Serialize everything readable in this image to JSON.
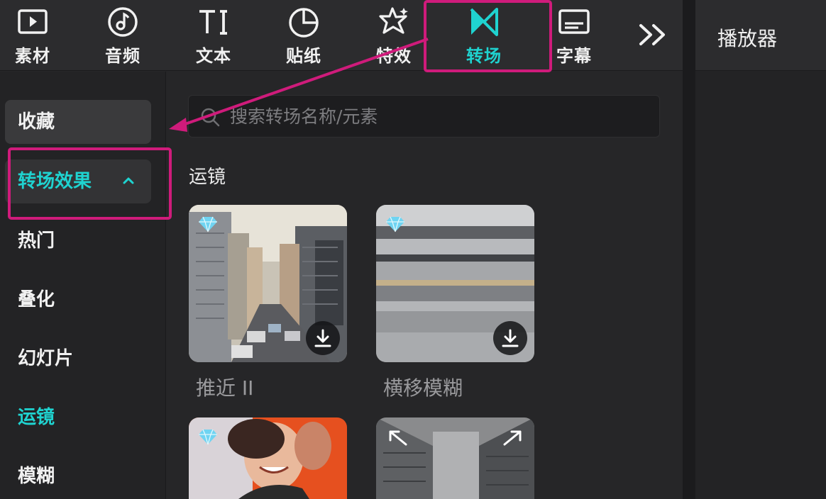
{
  "toolbar": {
    "tabs": [
      {
        "label": "素材",
        "icon": "media-icon"
      },
      {
        "label": "音频",
        "icon": "audio-icon"
      },
      {
        "label": "文本",
        "icon": "text-icon"
      },
      {
        "label": "贴纸",
        "icon": "sticker-icon"
      },
      {
        "label": "特效",
        "icon": "effects-icon"
      },
      {
        "label": "转场",
        "icon": "transition-icon",
        "active": true
      },
      {
        "label": "字幕",
        "icon": "subtitle-icon"
      }
    ],
    "more_icon": "double-chevron-right-icon"
  },
  "sidebar": {
    "items": [
      {
        "label": "收藏"
      },
      {
        "label": "转场效果",
        "expanded": true
      },
      {
        "label": "热门"
      },
      {
        "label": "叠化"
      },
      {
        "label": "幻灯片"
      },
      {
        "label": "运镜",
        "active": true
      },
      {
        "label": "模糊"
      }
    ]
  },
  "search": {
    "placeholder": "搜索转场名称/元素"
  },
  "main": {
    "section_title": "运镜",
    "cards": [
      {
        "label": "推近 II",
        "premium": true,
        "downloadable": true
      },
      {
        "label": "横移模糊",
        "premium": true,
        "downloadable": true
      },
      {
        "label": "",
        "premium": true,
        "downloadable": false
      },
      {
        "label": "",
        "premium": false,
        "downloadable": false
      }
    ]
  },
  "player": {
    "title": "播放器"
  },
  "colors": {
    "accent": "#1fd3d0",
    "highlight": "#cf1b7b",
    "panel_bg": "#262628",
    "toolbar_bg": "#2c2c2e"
  }
}
